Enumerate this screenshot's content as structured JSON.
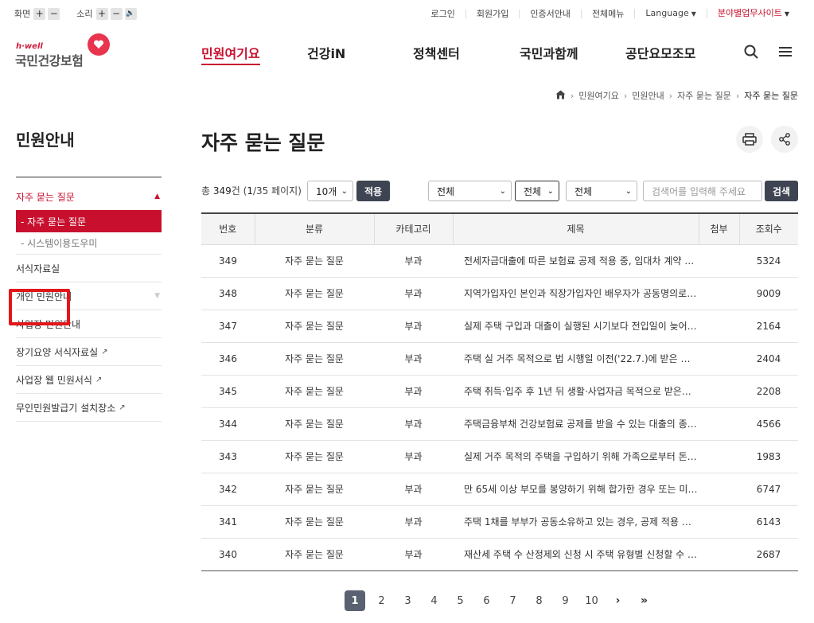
{
  "utility": {
    "screen_label": "화면",
    "sound_label": "소리",
    "plus": "+",
    "minus": "−",
    "speaker": "🔈",
    "links": [
      "로그인",
      "회원가입",
      "인증서안내",
      "전체메뉴"
    ],
    "language": "Language",
    "field_sites": "분야별업무사이트"
  },
  "header": {
    "logo_small": "h·well",
    "logo_main": "국민건강보험",
    "nav": [
      "민원여기요",
      "건강iN",
      "정책센터",
      "국민과함께",
      "공단요모조모"
    ],
    "active_nav": "민원여기요"
  },
  "breadcrumb": [
    "민원여기요",
    "민원안내",
    "자주 묻는 질문",
    "자주 묻는 질문"
  ],
  "sidebar": {
    "title": "민원안내",
    "active_group": "자주 묻는 질문",
    "sub_items": [
      "-  자주 묻는 질문",
      "-  시스템이용도우미"
    ],
    "items": [
      {
        "label": "서식자료실",
        "ext": false
      },
      {
        "label": "개인 민원안내",
        "ext": false
      },
      {
        "label": "사업장 민원안내",
        "ext": false
      },
      {
        "label": "장기요양 서식자료실",
        "ext": true
      },
      {
        "label": "사업장 웹 민원서식",
        "ext": true
      },
      {
        "label": "무인민원발급기 설치장소",
        "ext": true
      }
    ]
  },
  "content": {
    "title": "자주 묻는 질문",
    "count_prefix": "총 ",
    "count_num": "349",
    "count_mid": "건 (",
    "page_cur": "1",
    "count_tail": "/35 페이지)",
    "per_page": "10개",
    "apply": "적용",
    "filter1": "전체",
    "filter2": "전체",
    "filter3": "전체",
    "search_placeholder": "검색어를 입력해 주세요",
    "search_btn": "검색"
  },
  "table": {
    "headers": [
      "번호",
      "분류",
      "카테고리",
      "제목",
      "첨부",
      "조회수"
    ],
    "rows": [
      {
        "no": "349",
        "type": "자주 묻는 질문",
        "cat": "부과",
        "title": "전세자금대출에 따른 보험료 공제 적용 중, 임대차 계약 …",
        "attach": "",
        "views": "5324"
      },
      {
        "no": "348",
        "type": "자주 묻는 질문",
        "cat": "부과",
        "title": "지역가입자인 본인과 직장가입자인 배우자가 공동명의로…",
        "attach": "",
        "views": "9009"
      },
      {
        "no": "347",
        "type": "자주 묻는 질문",
        "cat": "부과",
        "title": "실제 주택 구입과 대출이 실행된 시기보다 전입일이 늦어…",
        "attach": "",
        "views": "2164"
      },
      {
        "no": "346",
        "type": "자주 묻는 질문",
        "cat": "부과",
        "title": "주택 실 거주 목적으로 법 시행일 이전('22.7.)에 받은 부…",
        "attach": "",
        "views": "2404"
      },
      {
        "no": "345",
        "type": "자주 묻는 질문",
        "cat": "부과",
        "title": "주택 취득·입주 후 1년 뒤 생활·사업자금 목적으로 받은…",
        "attach": "",
        "views": "2208"
      },
      {
        "no": "344",
        "type": "자주 묻는 질문",
        "cat": "부과",
        "title": "주택금융부채 건강보험료 공제를 받을 수 있는 대출의 종…",
        "attach": "",
        "views": "4566"
      },
      {
        "no": "343",
        "type": "자주 묻는 질문",
        "cat": "부과",
        "title": "실제 거주 목적의 주택을 구입하기 위해 가족으로부터 돈…",
        "attach": "",
        "views": "1983"
      },
      {
        "no": "342",
        "type": "자주 묻는 질문",
        "cat": "부과",
        "title": "만 65세 이상 부모를 봉양하기 위해 합가한 경우 또는 미…",
        "attach": "",
        "views": "6747"
      },
      {
        "no": "341",
        "type": "자주 묻는 질문",
        "cat": "부과",
        "title": "주택 1채를 부부가 공동소유하고 있는 경우, 공제 적용 대…",
        "attach": "",
        "views": "6143"
      },
      {
        "no": "340",
        "type": "자주 묻는 질문",
        "cat": "부과",
        "title": "재산세 주택 수 산정제외 신청 시 주택 유형별 신청할 수 …",
        "attach": "",
        "views": "2687"
      }
    ]
  },
  "pager": {
    "pages": [
      "1",
      "2",
      "3",
      "4",
      "5",
      "6",
      "7",
      "8",
      "9",
      "10"
    ],
    "next": "›",
    "last": "»"
  },
  "colors": {
    "accent": "#c8102e",
    "highlight": "#e3161b",
    "dark_btn": "#3e4452"
  }
}
